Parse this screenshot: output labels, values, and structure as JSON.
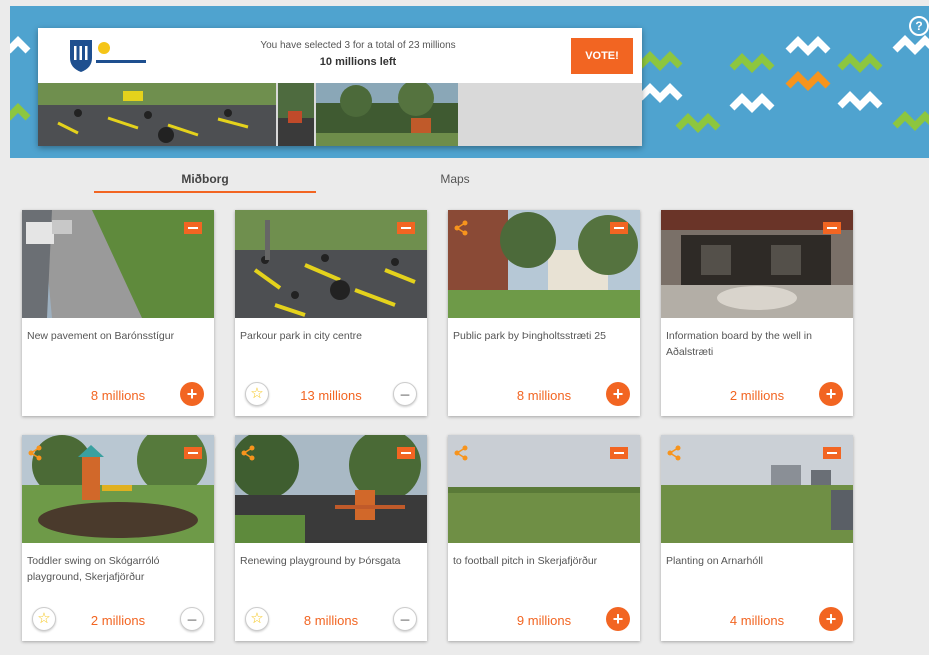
{
  "header": {
    "selection_text": "You have selected 3 for a total of 23 millions",
    "remaining_text": "10 millions left",
    "vote_label": "VOTE!",
    "help_glyph": "?",
    "logo_icon": "city-logo-icon"
  },
  "tabs": [
    {
      "label": "Miðborg",
      "active": true
    },
    {
      "label": "Maps",
      "active": false
    }
  ],
  "colors": {
    "accent": "#f26522",
    "banner": "#4fa3cf",
    "chevron_green": "#8dc63f",
    "chevron_white": "#ffffff"
  },
  "projects": [
    {
      "title": "New pavement on Barónsstígur",
      "price": "8 millions",
      "selected": false,
      "button_glyph": "+"
    },
    {
      "title": "Parkour park in city centre",
      "price": "13 millions",
      "selected": true,
      "button_glyph": "−",
      "star_glyph": "☆"
    },
    {
      "title": "Public park by Þingholtsstræti 25",
      "price": "8 millions",
      "selected": false,
      "button_glyph": "+"
    },
    {
      "title": "Information board by the well in Aðalstræti",
      "price": "2 millions",
      "selected": false,
      "button_glyph": "+"
    },
    {
      "title": "Toddler swing on Skógarróló playground, Skerjafjörður",
      "price": "2 millions",
      "selected": true,
      "button_glyph": "−",
      "star_glyph": "☆"
    },
    {
      "title": "Renewing playground by Þórsgata",
      "price": "8 millions",
      "selected": true,
      "button_glyph": "−",
      "star_glyph": "☆"
    },
    {
      "title": "to football pitch in Skerjafjörður",
      "price": "9 millions",
      "selected": false,
      "button_glyph": "+"
    },
    {
      "title": "Planting on Arnarhóll",
      "price": "4 millions",
      "selected": false,
      "button_glyph": "+"
    }
  ]
}
